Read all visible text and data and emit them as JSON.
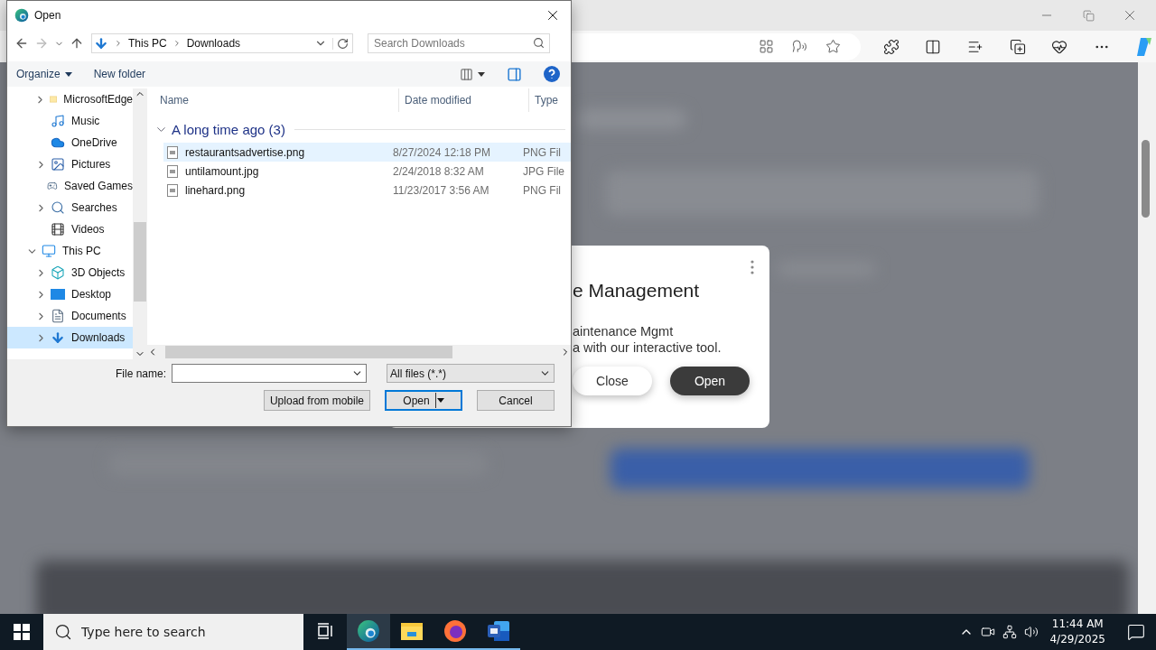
{
  "page_modal": {
    "title": "e Management",
    "lines": [
      "aintenance Mgmt",
      "a with our interactive tool."
    ],
    "buttons": [
      {
        "label": "Close",
        "kind": "secondary"
      },
      {
        "label": "Open",
        "kind": "primary"
      }
    ]
  },
  "dialog": {
    "title": "Open",
    "breadcrumb": [
      "This PC",
      "Downloads"
    ],
    "search": {
      "placeholder": "Search Downloads"
    },
    "commands": [
      {
        "label": "Organize",
        "dropdown": true
      },
      {
        "label": "New folder",
        "dropdown": false
      }
    ],
    "tree": [
      {
        "children": [
          {
            "label": "MicrosoftEdge",
            "kind": "folder",
            "expanded": false,
            "selected": false
          },
          {
            "label": "Music",
            "kind": "music",
            "selected": false
          },
          {
            "label": "OneDrive",
            "kind": "cloud",
            "selected": false
          },
          {
            "label": "Pictures",
            "kind": "pictures",
            "expanded": false,
            "selected": false
          },
          {
            "label": "Saved Games",
            "kind": "games",
            "selected": false
          },
          {
            "label": "Searches",
            "kind": "search",
            "expanded": false,
            "selected": false
          },
          {
            "label": "Videos",
            "kind": "videos",
            "selected": false
          }
        ]
      },
      {
        "label": "This PC",
        "kind": "pc",
        "expanded": true,
        "selected": false,
        "children": [
          {
            "label": "3D Objects",
            "kind": "cube",
            "expanded": false,
            "selected": false
          },
          {
            "label": "Desktop",
            "kind": "desktop",
            "expanded": false,
            "selected": false
          },
          {
            "label": "Documents",
            "kind": "documents",
            "expanded": false,
            "selected": false
          },
          {
            "label": "Downloads",
            "kind": "downloads",
            "expanded": false,
            "selected": true
          }
        ]
      }
    ],
    "columns": [
      "Name",
      "Date modified",
      "Type"
    ],
    "group": {
      "label": "A long time ago (3)",
      "expanded": true
    },
    "files": [
      {
        "name": "restaurantsadvertise.png",
        "date": "8/27/2024 12:18 PM",
        "type": "PNG Fil",
        "selected": true
      },
      {
        "name": "untilamount.jpg",
        "date": "2/24/2018 8:32 AM",
        "type": "JPG File",
        "selected": false
      },
      {
        "name": "linehard.png",
        "date": "11/23/2017 3:56 AM",
        "type": "PNG Fil",
        "selected": false
      }
    ],
    "file_name_label": "File name:",
    "filter": "All files (*.*)",
    "buttons": [
      {
        "label": "Upload from mobile",
        "kind": "plain"
      },
      {
        "label": "Open",
        "kind": "split"
      },
      {
        "label": "Cancel",
        "kind": "plain"
      }
    ]
  },
  "taskbar": {
    "search": {
      "placeholder": "Type here to search"
    },
    "apps": [
      {
        "kind": "task-view",
        "selected": false,
        "running": false
      },
      {
        "kind": "edge",
        "selected": true,
        "running": true
      },
      {
        "kind": "explorer",
        "selected": false,
        "running": true
      },
      {
        "kind": "firefox",
        "selected": false,
        "running": true
      },
      {
        "kind": "word",
        "selected": false,
        "running": true
      }
    ],
    "time": "11:44 AM",
    "date": "4/29/2025"
  }
}
